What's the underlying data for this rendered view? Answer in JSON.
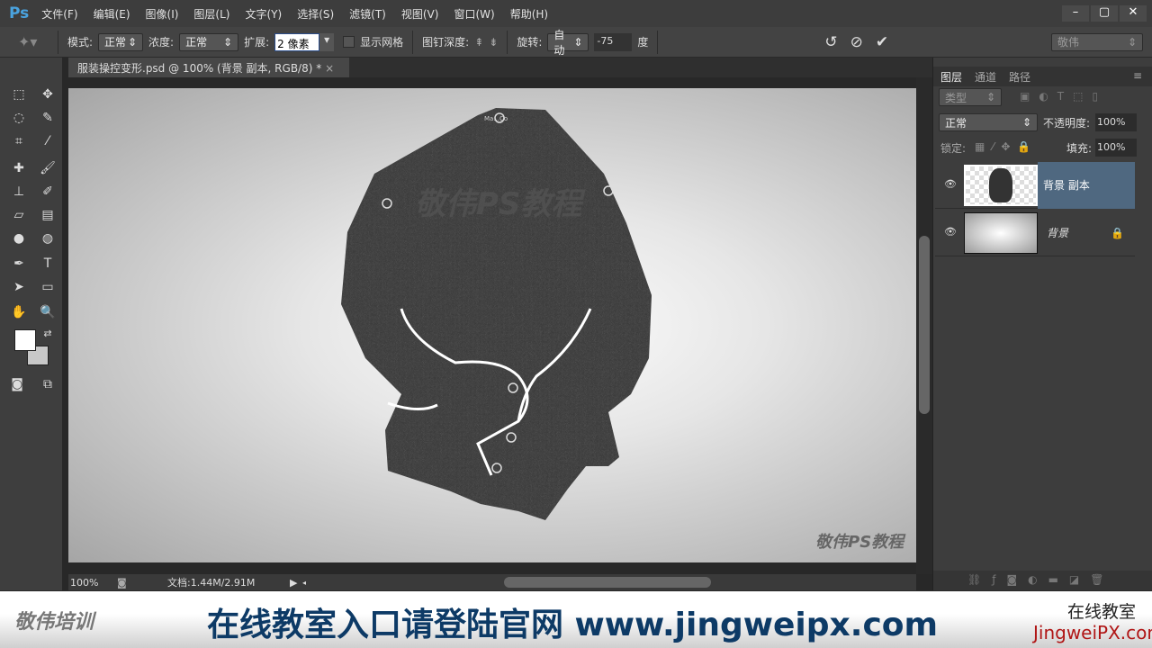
{
  "app": {
    "logo": "Ps",
    "menus": [
      "文件(F)",
      "编辑(E)",
      "图像(I)",
      "图层(L)",
      "文字(Y)",
      "选择(S)",
      "滤镜(T)",
      "视图(V)",
      "窗口(W)",
      "帮助(H)"
    ],
    "window_controls": [
      "–",
      "▢",
      "✕"
    ]
  },
  "options": {
    "mode_label": "模式:",
    "mode_value": "正常",
    "density_label": "浓度:",
    "density_value": "正常",
    "expand_label": "扩展:",
    "expand_value": "2 像素",
    "show_mesh_label": "显示网格",
    "pin_depth_label": "图钉深度:",
    "rotate_label": "旋转:",
    "rotate_mode": "自动",
    "rotate_value": "-75",
    "degree_label": "度",
    "workspace": "敬伟"
  },
  "document": {
    "tab_title": "服装操控变形.psd @ 100% (背景 副本, RGB/8) *",
    "watermark_center": "敬伟PS教程",
    "watermark_corner": "敬伟PS教程",
    "jacket_label": "Ma...Co"
  },
  "status": {
    "zoom": "100%",
    "doc_info": "文档:1.44M/2.91M"
  },
  "layers_panel": {
    "tabs": [
      "图层",
      "通道",
      "路径"
    ],
    "filter_label": "类型",
    "blend_mode": "正常",
    "opacity_label": "不透明度:",
    "opacity_value": "100%",
    "lock_label": "锁定:",
    "fill_label": "填充:",
    "fill_value": "100%",
    "layers": [
      {
        "name": "背景 副本",
        "selected": true
      },
      {
        "name": "背景",
        "locked": true
      }
    ]
  },
  "banner": {
    "brand": "敬伟培训",
    "slogan": "在线教室入口请登陆官网 www.jingweipx.com",
    "right_top": "在线教室",
    "right_bottom": "JingweiPX.com",
    "slogan_color": "#0d3a66",
    "right_color": "#b01515"
  }
}
